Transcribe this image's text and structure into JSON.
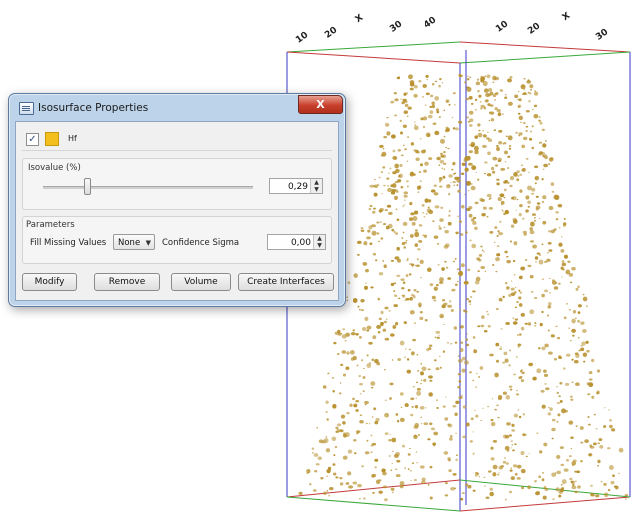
{
  "viewport": {
    "axis_top_left_labels": [
      "10",
      "20",
      "X",
      "30",
      "40"
    ],
    "axis_top_right_labels": [
      "10",
      "20",
      "X",
      "30"
    ]
  },
  "dialog": {
    "title": "Isosurface Properties",
    "close_glyph": "X",
    "isosurface": {
      "checked": true,
      "check_glyph": "✓",
      "color": "#f2bf1d",
      "name": "Hf"
    },
    "isovalue": {
      "label": "Isovalue (%)",
      "value": "0,29",
      "slider_fraction": 0.21,
      "spin_up": "▲",
      "spin_down": "▼"
    },
    "parameters": {
      "label": "Parameters",
      "fill_missing_label": "Fill Missing Values",
      "fill_missing_value": "None",
      "combo_arrow": "▼",
      "confidence_label": "Confidence Sigma",
      "confidence_value": "0,00"
    },
    "buttons": {
      "modify": "Modify",
      "remove": "Remove",
      "volume": "Volume",
      "create_interfaces": "Create Interfaces"
    }
  },
  "colors": {
    "particle": "#b8912e",
    "axis_red": "#c43a3a",
    "axis_green": "#3aa83a",
    "axis_blue": "#3a3ac4"
  }
}
